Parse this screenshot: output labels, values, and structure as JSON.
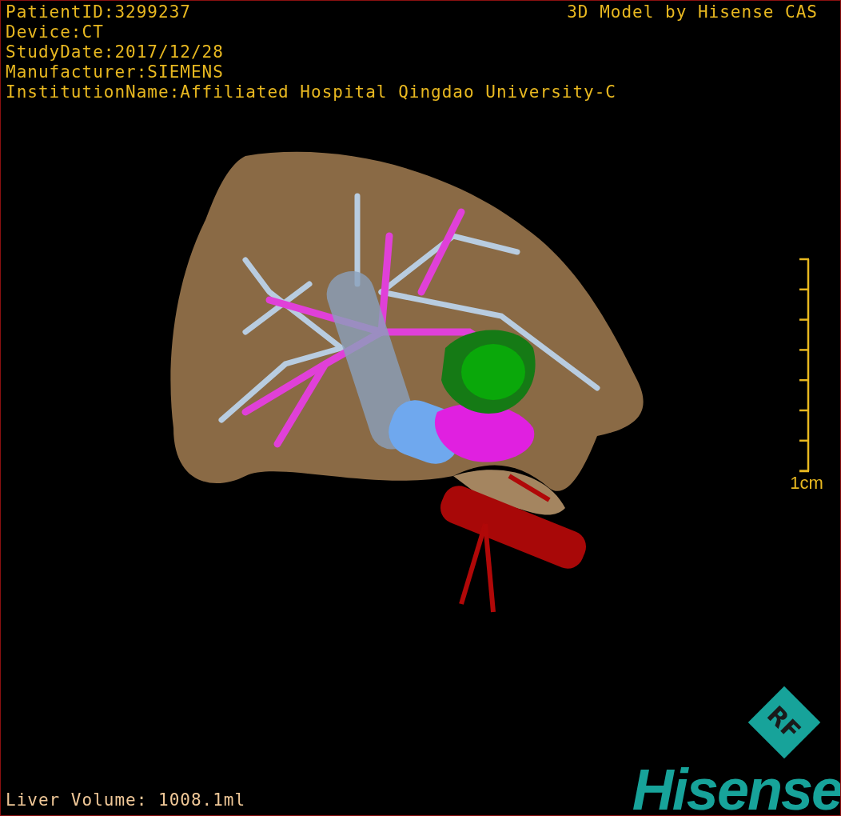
{
  "study_info": [
    "PatientID:3299237",
    "Device:CT",
    "StudyDate:2017/12/28",
    "Manufacturer:SIEMENS",
    "InstitutionName:Affiliated Hospital Qingdao University-C"
  ],
  "credit": "3D Model by Hisense CAS",
  "scale_bar": {
    "label": "1cm"
  },
  "measurement": "Liver Volume: 1008.1ml",
  "logo": {
    "badge": "RF",
    "wordmark": "Hisense"
  }
}
